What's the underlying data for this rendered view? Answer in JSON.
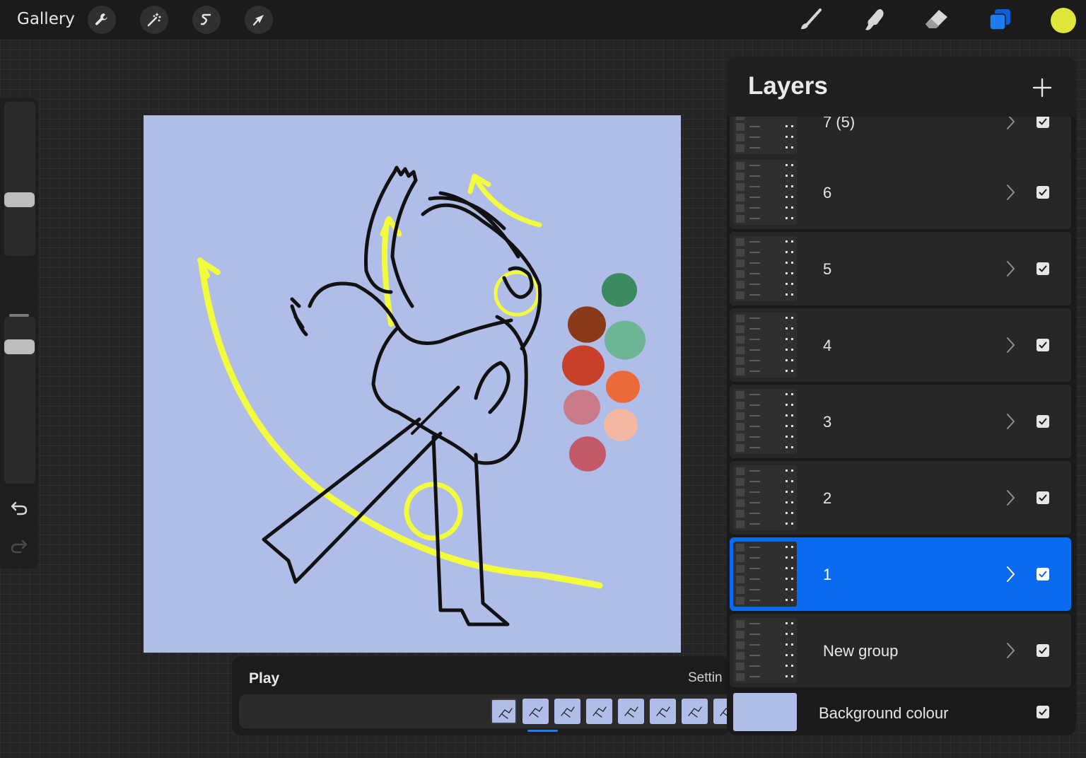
{
  "topbar": {
    "gallery_label": "Gallery",
    "left_tools": [
      "wrench-icon",
      "magic-wand-icon",
      "selection-icon",
      "transform-arrow-icon"
    ],
    "right_tools": [
      "brush-icon",
      "smudge-icon",
      "eraser-icon",
      "layers-icon"
    ],
    "active_tool": "layers-icon",
    "current_color": "#dfe53a",
    "accent_color": "#1e7cf2"
  },
  "sidebar": {
    "size_slider_level": 0.35,
    "opacity_slider_level": 0.85,
    "tools": [
      "modify-square-icon",
      "undo-icon",
      "redo-icon"
    ]
  },
  "canvas": {
    "background": "#b0bde8",
    "palette_colors": [
      "#3c8a60",
      "#8a3a18",
      "#6db594",
      "#c8402a",
      "#ec6a3a",
      "#c97b8a",
      "#f4b9a0",
      "#c25a6a"
    ],
    "highlight_color": "#f3fc3c"
  },
  "animation": {
    "play_label": "Play",
    "settings_label": "Settin",
    "frame_count": 8,
    "selected_frame": 1
  },
  "layers_panel": {
    "title": "Layers",
    "add_icon": "plus-icon",
    "layers": [
      {
        "name": "7 (5)",
        "visible": true,
        "active": false
      },
      {
        "name": "6",
        "visible": true,
        "active": false
      },
      {
        "name": "5",
        "visible": true,
        "active": false
      },
      {
        "name": "4",
        "visible": true,
        "active": false
      },
      {
        "name": "3",
        "visible": true,
        "active": false
      },
      {
        "name": "2",
        "visible": true,
        "active": false
      },
      {
        "name": "1",
        "visible": true,
        "active": true
      },
      {
        "name": "New group",
        "visible": true,
        "active": false
      }
    ],
    "background": {
      "name": "Background colour",
      "color": "#b0bde8",
      "visible": true
    }
  }
}
